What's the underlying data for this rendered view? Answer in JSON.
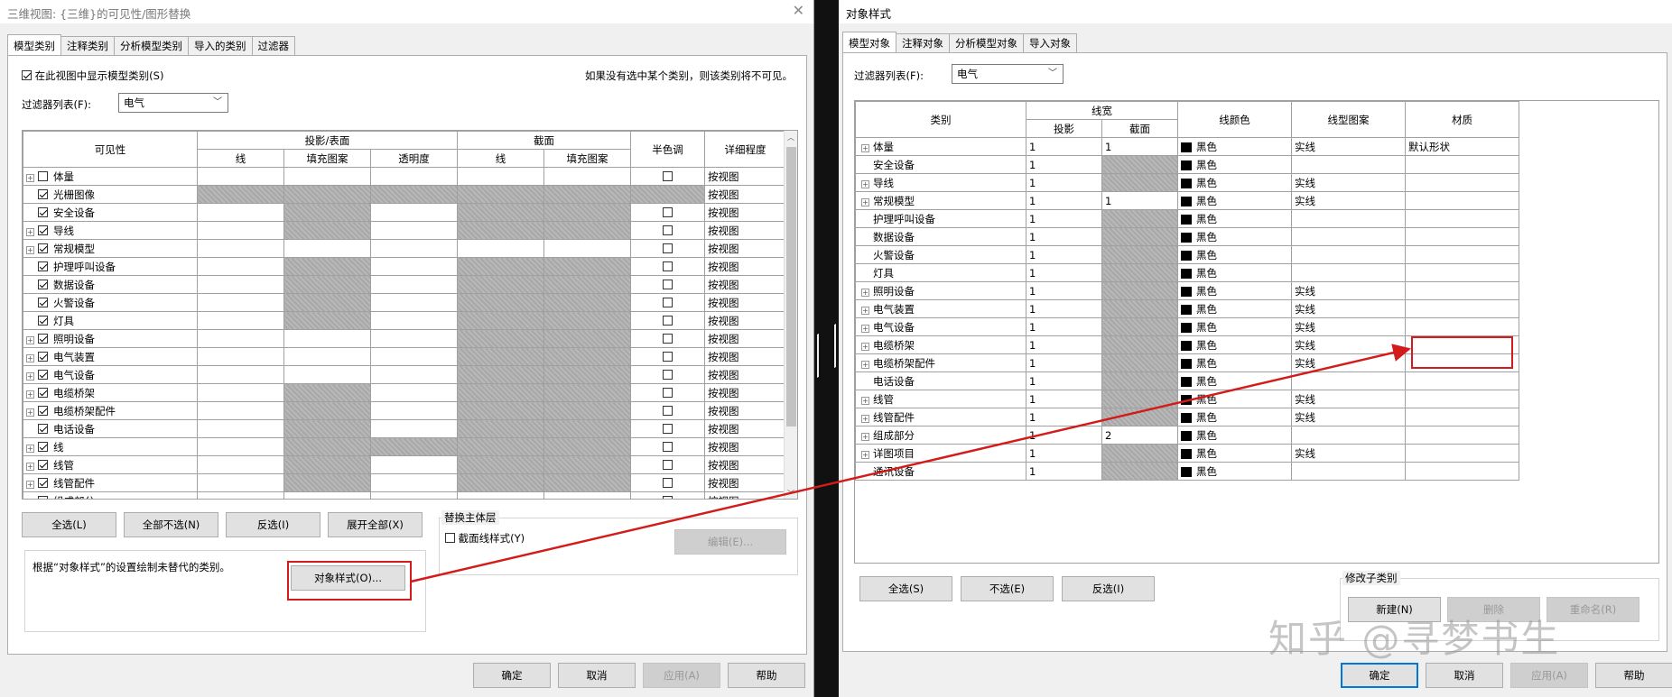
{
  "left": {
    "title": "三维视图: {三维}的可见性/图形替换",
    "tabs": [
      "模型类别",
      "注释类别",
      "分析模型类别",
      "导入的类别",
      "过滤器"
    ],
    "show_checkbox_label": "在此视图中显示模型类别(S)",
    "hint": "如果没有选中某个类别，则该类别将不可见。",
    "filter_label": "过滤器列表(F):",
    "filter_value": "电气",
    "headers": {
      "visibility": "可见性",
      "proj": "投影/表面",
      "cut": "截面",
      "halftone": "半色调",
      "detail": "详细程度",
      "line": "线",
      "pattern": "填充图案",
      "transparency": "透明度"
    },
    "rows": [
      {
        "name": "体量",
        "checked": false,
        "exp": true,
        "g": [
          0,
          0,
          0,
          0,
          0
        ],
        "ht": true,
        "detail": "按视图"
      },
      {
        "name": "光栅图像",
        "checked": true,
        "exp": false,
        "g": [
          1,
          1,
          1,
          1,
          1
        ],
        "ht": false,
        "detail": "按视图"
      },
      {
        "name": "安全设备",
        "checked": true,
        "exp": false,
        "g": [
          0,
          1,
          0,
          1,
          1
        ],
        "ht": true,
        "detail": "按视图"
      },
      {
        "name": "导线",
        "checked": true,
        "exp": true,
        "g": [
          0,
          1,
          0,
          1,
          1
        ],
        "ht": true,
        "detail": "按视图"
      },
      {
        "name": "常规模型",
        "checked": true,
        "exp": true,
        "g": [
          0,
          0,
          0,
          0,
          0
        ],
        "ht": true,
        "detail": "按视图"
      },
      {
        "name": "护理呼叫设备",
        "checked": true,
        "exp": false,
        "g": [
          0,
          1,
          0,
          1,
          1
        ],
        "ht": true,
        "detail": "按视图"
      },
      {
        "name": "数据设备",
        "checked": true,
        "exp": false,
        "g": [
          0,
          1,
          0,
          1,
          1
        ],
        "ht": true,
        "detail": "按视图"
      },
      {
        "name": "火警设备",
        "checked": true,
        "exp": false,
        "g": [
          0,
          1,
          0,
          1,
          1
        ],
        "ht": true,
        "detail": "按视图"
      },
      {
        "name": "灯具",
        "checked": true,
        "exp": false,
        "g": [
          0,
          1,
          0,
          1,
          1
        ],
        "ht": true,
        "detail": "按视图"
      },
      {
        "name": "照明设备",
        "checked": true,
        "exp": true,
        "g": [
          0,
          0,
          0,
          1,
          1
        ],
        "ht": true,
        "detail": "按视图"
      },
      {
        "name": "电气装置",
        "checked": true,
        "exp": true,
        "g": [
          0,
          0,
          0,
          1,
          1
        ],
        "ht": true,
        "detail": "按视图"
      },
      {
        "name": "电气设备",
        "checked": true,
        "exp": true,
        "g": [
          0,
          0,
          0,
          1,
          1
        ],
        "ht": true,
        "detail": "按视图"
      },
      {
        "name": "电缆桥架",
        "checked": true,
        "exp": true,
        "g": [
          0,
          1,
          0,
          1,
          1
        ],
        "ht": true,
        "detail": "按视图"
      },
      {
        "name": "电缆桥架配件",
        "checked": true,
        "exp": true,
        "g": [
          0,
          1,
          0,
          1,
          1
        ],
        "ht": true,
        "detail": "按视图"
      },
      {
        "name": "电话设备",
        "checked": true,
        "exp": false,
        "g": [
          0,
          1,
          0,
          1,
          1
        ],
        "ht": true,
        "detail": "按视图"
      },
      {
        "name": "线",
        "checked": true,
        "exp": true,
        "g": [
          0,
          1,
          1,
          1,
          1
        ],
        "ht": true,
        "detail": "按视图"
      },
      {
        "name": "线管",
        "checked": true,
        "exp": true,
        "g": [
          0,
          1,
          0,
          1,
          1
        ],
        "ht": true,
        "detail": "按视图"
      },
      {
        "name": "线管配件",
        "checked": true,
        "exp": true,
        "g": [
          0,
          1,
          0,
          1,
          1
        ],
        "ht": true,
        "detail": "按视图"
      },
      {
        "name": "组成部分",
        "checked": false,
        "exp": true,
        "g": [
          0,
          0,
          0,
          0,
          0
        ],
        "ht": true,
        "detail": "按视图"
      }
    ],
    "buttons": {
      "select_all": "全选(L)",
      "select_none": "全部不选(N)",
      "invert": "反选(I)",
      "expand_all": "展开全部(X)",
      "object_styles": "对象样式(O)...",
      "edit": "编辑(E)...",
      "ok": "确定",
      "cancel": "取消",
      "apply": "应用(A)",
      "help": "帮助"
    },
    "host_group": "替换主体层",
    "cut_linestyle": "截面线样式(Y)",
    "info": "根据“对象样式”的设置绘制未替代的类别。"
  },
  "right": {
    "title": "对象样式",
    "tabs": [
      "模型对象",
      "注释对象",
      "分析模型对象",
      "导入对象"
    ],
    "filter_label": "过滤器列表(F):",
    "filter_value": "电气",
    "headers": {
      "category": "类别",
      "lineweight": "线宽",
      "projection": "投影",
      "cut": "截面",
      "color": "线颜色",
      "pattern": "线型图案",
      "material": "材质"
    },
    "rows": [
      {
        "name": "体量",
        "exp": true,
        "proj": "1",
        "cut": "1",
        "g": false,
        "color": "黑色",
        "pattern": "实线",
        "material": "默认形状"
      },
      {
        "name": "安全设备",
        "exp": false,
        "proj": "1",
        "cut": "",
        "g": true,
        "color": "黑色",
        "pattern": "",
        "material": ""
      },
      {
        "name": "导线",
        "exp": true,
        "proj": "1",
        "cut": "",
        "g": true,
        "color": "黑色",
        "pattern": "实线",
        "material": ""
      },
      {
        "name": "常规模型",
        "exp": true,
        "proj": "1",
        "cut": "1",
        "g": false,
        "color": "黑色",
        "pattern": "实线",
        "material": ""
      },
      {
        "name": "护理呼叫设备",
        "exp": false,
        "proj": "1",
        "cut": "",
        "g": true,
        "color": "黑色",
        "pattern": "",
        "material": ""
      },
      {
        "name": "数据设备",
        "exp": false,
        "proj": "1",
        "cut": "",
        "g": true,
        "color": "黑色",
        "pattern": "",
        "material": ""
      },
      {
        "name": "火警设备",
        "exp": false,
        "proj": "1",
        "cut": "",
        "g": true,
        "color": "黑色",
        "pattern": "",
        "material": ""
      },
      {
        "name": "灯具",
        "exp": false,
        "proj": "1",
        "cut": "",
        "g": true,
        "color": "黑色",
        "pattern": "",
        "material": ""
      },
      {
        "name": "照明设备",
        "exp": true,
        "proj": "1",
        "cut": "",
        "g": true,
        "color": "黑色",
        "pattern": "实线",
        "material": ""
      },
      {
        "name": "电气装置",
        "exp": true,
        "proj": "1",
        "cut": "",
        "g": true,
        "color": "黑色",
        "pattern": "实线",
        "material": ""
      },
      {
        "name": "电气设备",
        "exp": true,
        "proj": "1",
        "cut": "",
        "g": true,
        "color": "黑色",
        "pattern": "实线",
        "material": ""
      },
      {
        "name": "电缆桥架",
        "exp": true,
        "proj": "1",
        "cut": "",
        "g": true,
        "color": "黑色",
        "pattern": "实线",
        "material": ""
      },
      {
        "name": "电缆桥架配件",
        "exp": true,
        "proj": "1",
        "cut": "",
        "g": true,
        "color": "黑色",
        "pattern": "实线",
        "material": ""
      },
      {
        "name": "电话设备",
        "exp": false,
        "proj": "1",
        "cut": "",
        "g": true,
        "color": "黑色",
        "pattern": "",
        "material": ""
      },
      {
        "name": "线管",
        "exp": true,
        "proj": "1",
        "cut": "",
        "g": true,
        "color": "黑色",
        "pattern": "实线",
        "material": ""
      },
      {
        "name": "线管配件",
        "exp": true,
        "proj": "1",
        "cut": "",
        "g": true,
        "color": "黑色",
        "pattern": "实线",
        "material": ""
      },
      {
        "name": "组成部分",
        "exp": true,
        "proj": "1",
        "cut": "2",
        "g": false,
        "color": "黑色",
        "pattern": "",
        "material": ""
      },
      {
        "name": "详图项目",
        "exp": true,
        "proj": "1",
        "cut": "",
        "g": true,
        "color": "黑色",
        "pattern": "实线",
        "material": ""
      },
      {
        "name": "通讯设备",
        "exp": false,
        "proj": "1",
        "cut": "",
        "g": true,
        "color": "黑色",
        "pattern": "",
        "material": ""
      }
    ],
    "buttons": {
      "select_all": "全选(S)",
      "select_none": "不选(E)",
      "invert": "反选(I)",
      "new": "新建(N)",
      "delete": "删除",
      "rename": "重命名(R)",
      "ok": "确定",
      "cancel": "取消",
      "apply": "应用(A)",
      "help": "帮助"
    },
    "subcat_group": "修改子类别"
  },
  "watermark": "知乎 @寻梦书生",
  "colors": {
    "annotation": "#d31b1b",
    "focus": "#0078d7"
  }
}
